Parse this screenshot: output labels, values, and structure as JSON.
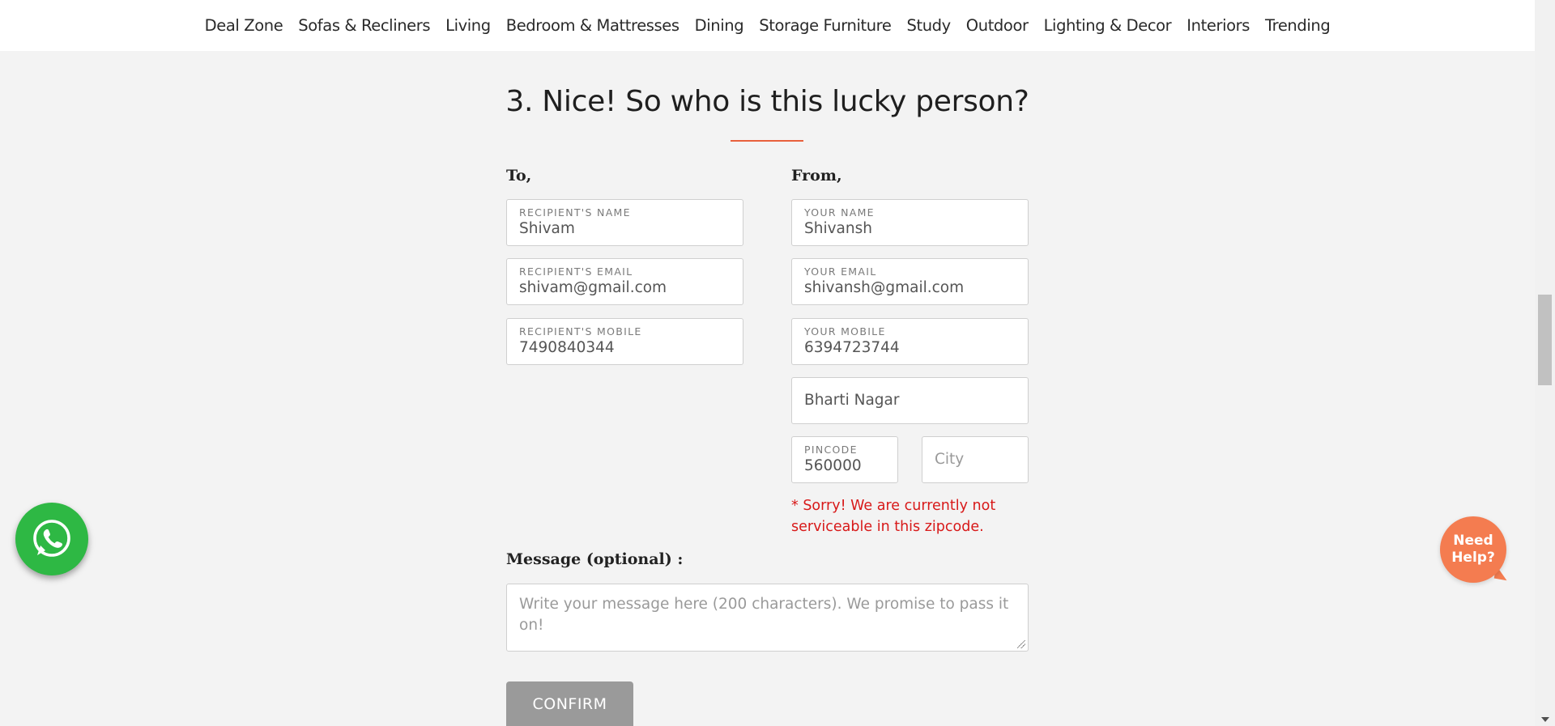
{
  "nav": {
    "items": [
      "Deal Zone",
      "Sofas & Recliners",
      "Living",
      "Bedroom & Mattresses",
      "Dining",
      "Storage Furniture",
      "Study",
      "Outdoor",
      "Lighting & Decor",
      "Interiors",
      "Trending"
    ]
  },
  "section": {
    "title": "3. Nice! So who is this lucky person?",
    "accent_color": "#e8603c"
  },
  "to": {
    "label": "To,",
    "name": {
      "label": "RECIPIENT'S NAME",
      "value": "Shivam"
    },
    "email": {
      "label": "RECIPIENT'S EMAIL",
      "value": "shivam@gmail.com"
    },
    "mobile": {
      "label": "RECIPIENT'S MOBILE",
      "value": "7490840344"
    }
  },
  "from": {
    "label": "From,",
    "name": {
      "label": "YOUR NAME",
      "value": "Shivansh"
    },
    "email": {
      "label": "YOUR EMAIL",
      "value": "shivansh@gmail.com"
    },
    "mobile": {
      "label": "YOUR MOBILE",
      "value": "6394723744"
    },
    "address": {
      "value": "Bharti Nagar"
    },
    "pincode": {
      "label": "PINCODE",
      "value": "560000"
    },
    "city": {
      "placeholder": "City"
    },
    "error": "* Sorry! We are currently not serviceable in this zipcode."
  },
  "message": {
    "label": "Message (optional) :",
    "placeholder": "Write your message here (200 characters). We promise to pass it on!"
  },
  "confirm_label": "CONFIRM",
  "help": {
    "line1": "Need",
    "line2": "Help?",
    "color": "#f47c50"
  },
  "whatsapp": {
    "icon": "whatsapp-icon",
    "color": "#2eb844"
  }
}
